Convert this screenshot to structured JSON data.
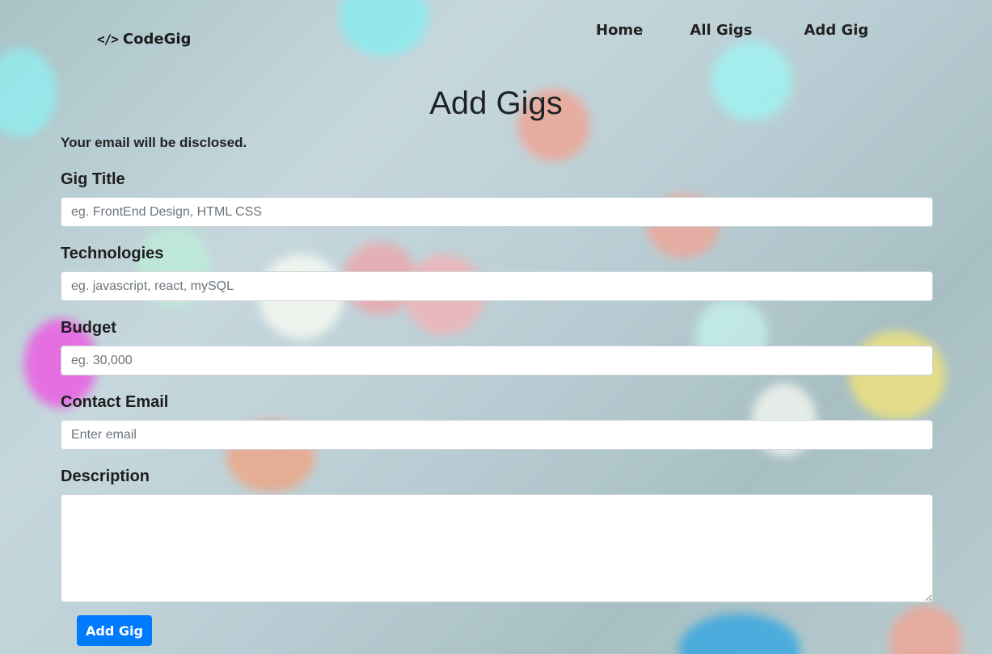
{
  "header": {
    "brand_icon": "</>",
    "brand_name": "CodeGig",
    "nav": [
      {
        "label": "Home"
      },
      {
        "label": "All Gigs"
      },
      {
        "label": "Add Gig"
      }
    ]
  },
  "page": {
    "title": "Add Gigs",
    "note": "Your email will be disclosed."
  },
  "form": {
    "gig_title": {
      "label": "Gig Title",
      "placeholder": "eg. FrontEnd Design, HTML CSS",
      "value": ""
    },
    "technologies": {
      "label": "Technologies",
      "placeholder": "eg. javascript, react, mySQL",
      "value": ""
    },
    "budget": {
      "label": "Budget",
      "placeholder": "eg. 30,000",
      "value": ""
    },
    "contact_email": {
      "label": "Contact Email",
      "placeholder": "Enter email",
      "value": ""
    },
    "description": {
      "label": "Description",
      "value": ""
    },
    "submit_label": "Add Gig"
  },
  "colors": {
    "button_bg": "#007bff",
    "button_text": "#ffffff",
    "background": "#b9cfd2"
  },
  "icons": {
    "brand": "code-icon"
  }
}
